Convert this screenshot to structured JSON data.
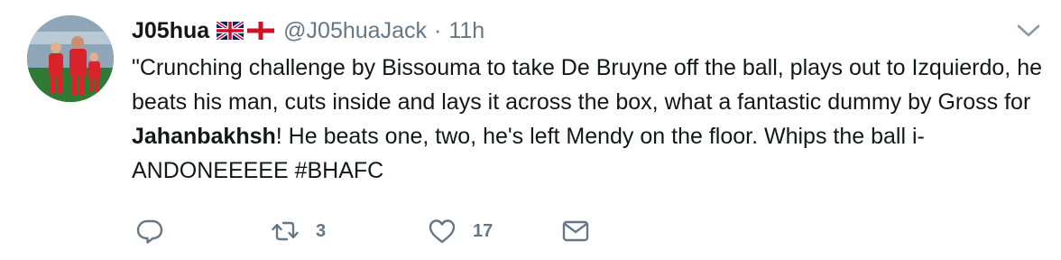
{
  "tweet": {
    "display_name": "J05hua",
    "flags": [
      "united-kingdom-flag-icon",
      "england-flag-icon"
    ],
    "handle": "@J05huaJack",
    "separator": "·",
    "time": "11h",
    "text_before": "\"Crunching challenge by Bissouma to take De Bruyne off the ball, plays out to Izquierdo, he beats his man, cuts inside and lays it across the box, what a fantastic dummy by Gross for ",
    "text_bold": "Jahanbakhsh",
    "text_after": "! He beats one, two, he's left Mendy on the floor. Whips the ball i- ANDONEEEEE #BHAFC",
    "actions": {
      "reply_count": "",
      "retweet_count": "3",
      "like_count": "17"
    }
  },
  "colors": {
    "text": "#14171a",
    "secondary": "#657786",
    "background": "#ffffff"
  }
}
